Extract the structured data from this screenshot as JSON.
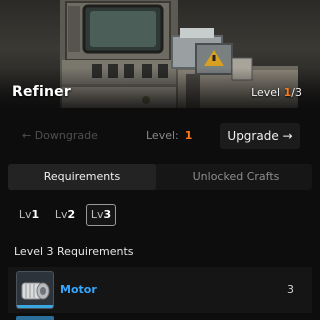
{
  "station": {
    "name": "Refiner",
    "level_prefix": "Level ",
    "level_current": "1",
    "level_total": "/3"
  },
  "level_controls": {
    "downgrade_label": "← Downgrade",
    "level_label": "Level:",
    "level_value": "1",
    "upgrade_label": "Upgrade →"
  },
  "tabs": [
    {
      "label": "Requirements",
      "active": true
    },
    {
      "label": "Unlocked Crafts",
      "active": false
    }
  ],
  "level_buttons": [
    {
      "prefix": "Lv",
      "num": "1",
      "selected": false
    },
    {
      "prefix": "Lv",
      "num": "2",
      "selected": false
    },
    {
      "prefix": "Lv",
      "num": "3",
      "selected": true
    }
  ],
  "requirements": {
    "title": "Level 3 Requirements",
    "items": [
      {
        "name": "Motor",
        "qty": "3",
        "icon": "motor-icon",
        "rarity_color": "#3ba7e0"
      }
    ]
  },
  "colors": {
    "accent": "#ff7a1a",
    "item_name": "#35a7ff"
  }
}
